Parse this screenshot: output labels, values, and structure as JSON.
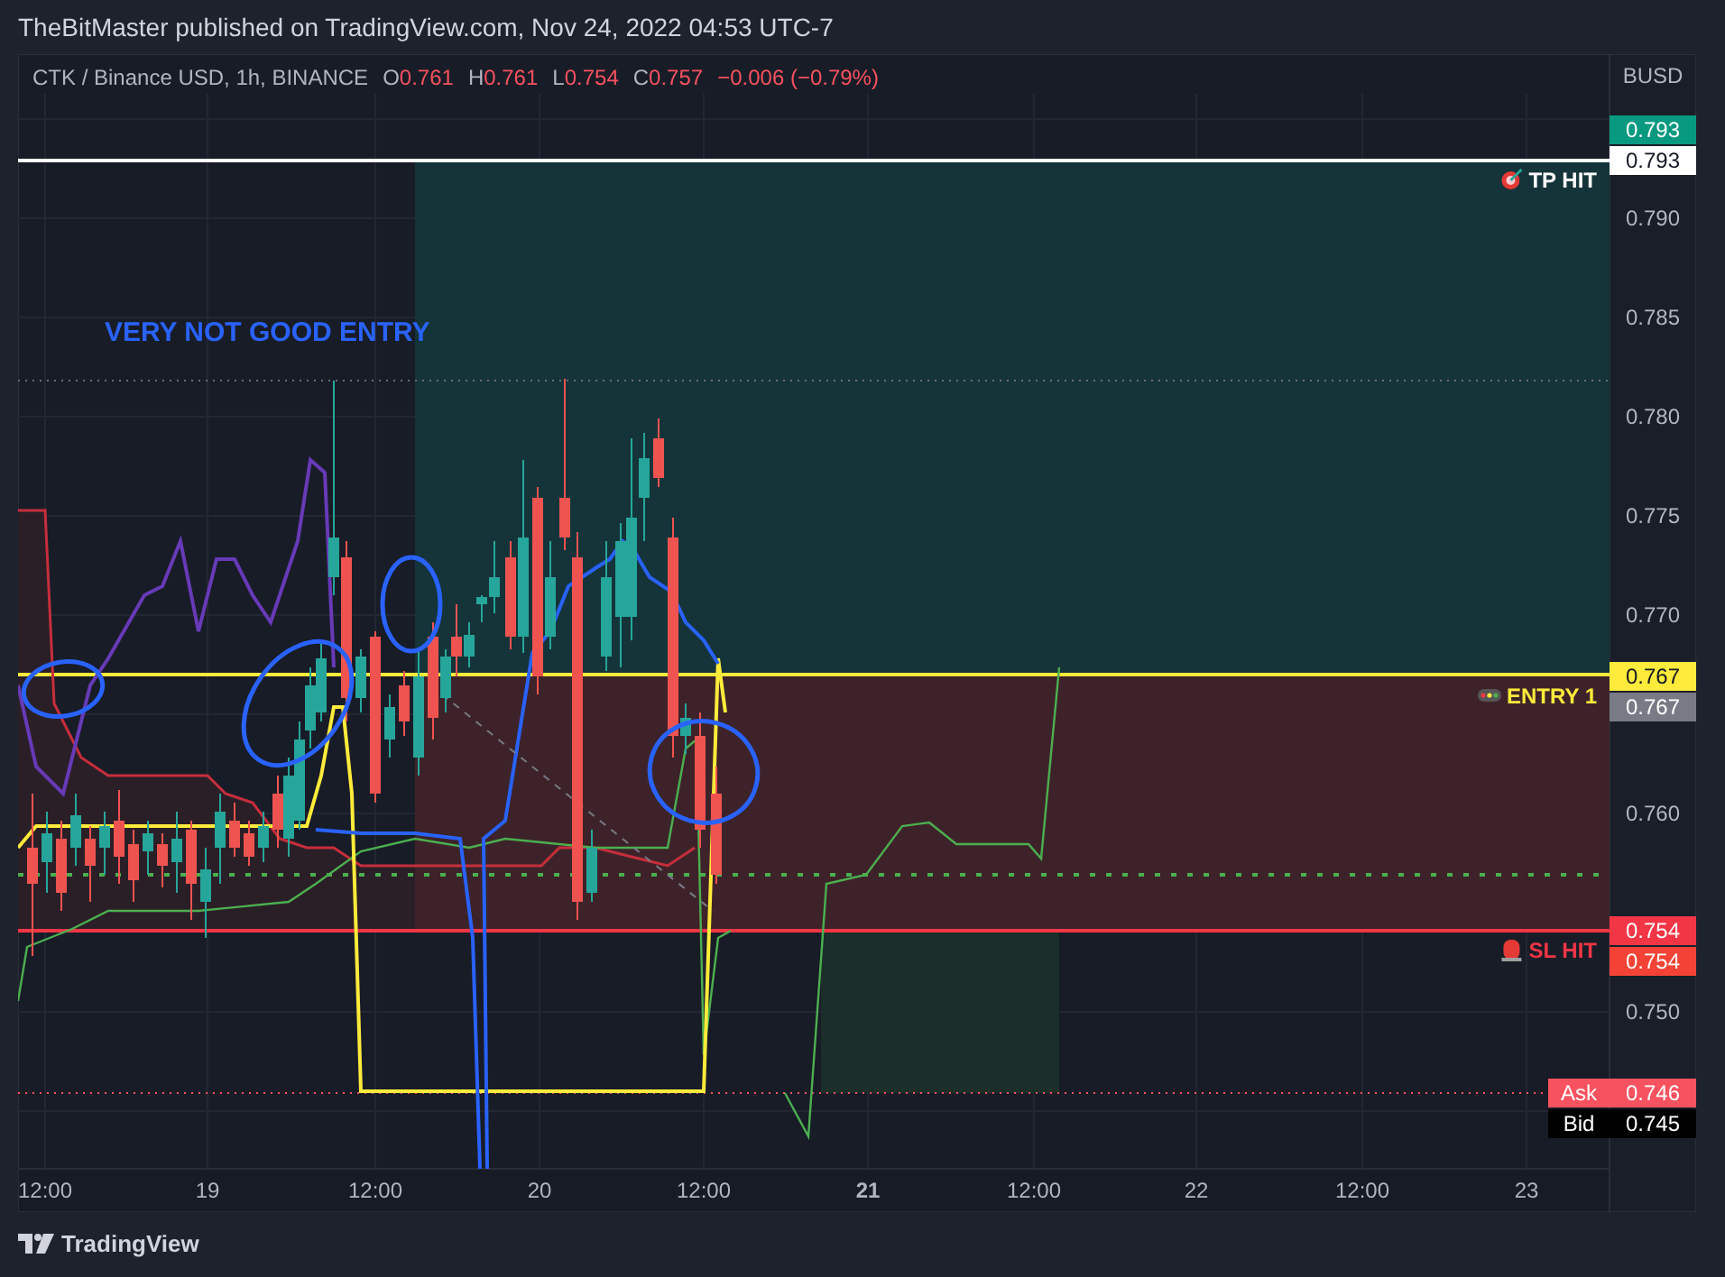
{
  "attribution": "TheBitMaster published on TradingView.com, Nov 24, 2022 04:53 UTC-7",
  "legend": {
    "symbol": "CTK / Binance USD, 1h, BINANCE",
    "ohlc": [
      {
        "label": "O",
        "value": "0.761"
      },
      {
        "label": "H",
        "value": "0.761"
      },
      {
        "label": "L",
        "value": "0.754"
      },
      {
        "label": "C",
        "value": "0.757"
      }
    ],
    "change": "−0.006 (−0.79%)"
  },
  "annotation": "VERY NOT GOOD ENTRY",
  "position_labels": [
    {
      "kind": "tp",
      "text": "TP HIT"
    },
    {
      "kind": "entry",
      "text": "ENTRY 1"
    },
    {
      "kind": "sl",
      "text": "SL HIT"
    }
  ],
  "price_axis": {
    "currency": "BUSD",
    "ticks": [
      "0.790",
      "0.785",
      "0.780",
      "0.775",
      "0.770",
      "0.760",
      "0.750"
    ]
  },
  "price_tags": [
    {
      "text": "0.793",
      "color": "#089981"
    },
    {
      "text": "0.793",
      "color": "#ffffff"
    },
    {
      "text": "0.767",
      "color": "#ffeb3b"
    },
    {
      "text": "0.767",
      "color": "#787b86"
    },
    {
      "text": "0.754",
      "color": "#f23645"
    },
    {
      "text": "0.754",
      "color": "#f44336"
    },
    {
      "text": "0.746",
      "color": "#f7525f",
      "label": "Ask"
    },
    {
      "text": "0.745",
      "color": "#000000",
      "label": "Bid"
    }
  ],
  "time_axis": [
    {
      "label": "12:00",
      "bold": false
    },
    {
      "label": "19",
      "bold": false
    },
    {
      "label": "12:00",
      "bold": false
    },
    {
      "label": "20",
      "bold": false
    },
    {
      "label": "12:00",
      "bold": false
    },
    {
      "label": "21",
      "bold": true
    },
    {
      "label": "12:00",
      "bold": false
    },
    {
      "label": "22",
      "bold": false
    },
    {
      "label": "12:00",
      "bold": false
    },
    {
      "label": "23",
      "bold": false
    }
  ],
  "footer": {
    "brand": "TradingView"
  }
}
